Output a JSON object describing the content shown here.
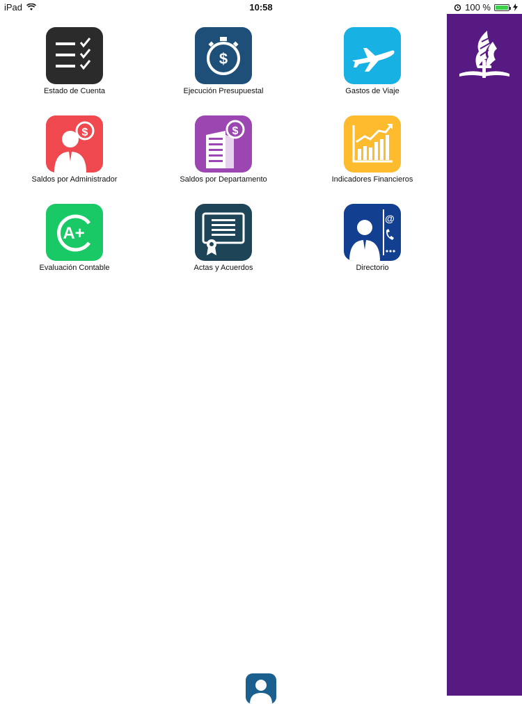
{
  "status_bar": {
    "device": "iPad",
    "time": "10:58",
    "battery": "100 %",
    "battery_level": 1.0
  },
  "tiles": [
    {
      "label": "Estado de Cuenta",
      "icon": "checklist-icon",
      "color": "#2b2b2b"
    },
    {
      "label": "Ejecución Presupuestal",
      "icon": "stopwatch-dollar-icon",
      "color": "#1d4f78"
    },
    {
      "label": "Gastos de Viaje",
      "icon": "airplane-icon",
      "color": "#17b1e3"
    },
    {
      "label": "Saldos por Administrador",
      "icon": "admin-dollar-icon",
      "color": "#f0484f"
    },
    {
      "label": "Saldos por Departamento",
      "icon": "building-dollar-icon",
      "color": "#9b46b1"
    },
    {
      "label": "Indicadores Financieros",
      "icon": "growth-chart-icon",
      "color": "#fdbb2d"
    },
    {
      "label": "Evaluación Contable",
      "icon": "a-plus-grade-icon",
      "color": "#18c965"
    },
    {
      "label": "Actas y Acuerdos",
      "icon": "certificate-icon",
      "color": "#1e4457"
    },
    {
      "label": "Directorio",
      "icon": "contact-card-icon",
      "color": "#123f8f"
    }
  ],
  "sidebar": {
    "color": "#561a82",
    "logo_icon": "church-logo-icon"
  },
  "footer": {
    "profile_icon": "user-profile-icon",
    "color": "#1b5f8e"
  }
}
